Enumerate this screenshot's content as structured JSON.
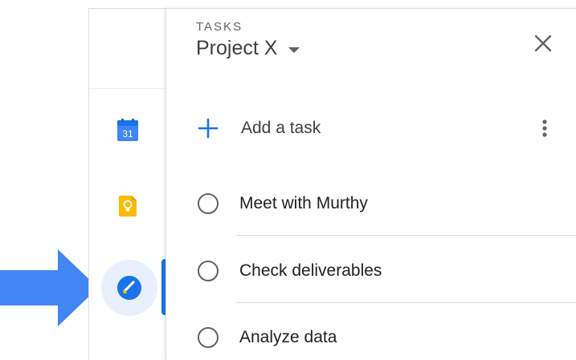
{
  "rail": {
    "icons": [
      {
        "name": "google-calendar-icon",
        "label": "31",
        "color": "#4285f4"
      },
      {
        "name": "google-keep-icon",
        "color": "#fbbc04"
      },
      {
        "name": "google-tasks-icon",
        "color": "#1a73e8",
        "active": true
      }
    ]
  },
  "annotation": {
    "arrow_color": "#4285f4"
  },
  "panel": {
    "eyebrow": "TASKS",
    "list_name": "Project X",
    "add_task_label": "Add a task",
    "tasks": [
      {
        "title": "Meet with Murthy",
        "completed": false
      },
      {
        "title": "Check deliverables",
        "completed": false
      },
      {
        "title": "Analyze data",
        "completed": false
      }
    ]
  }
}
